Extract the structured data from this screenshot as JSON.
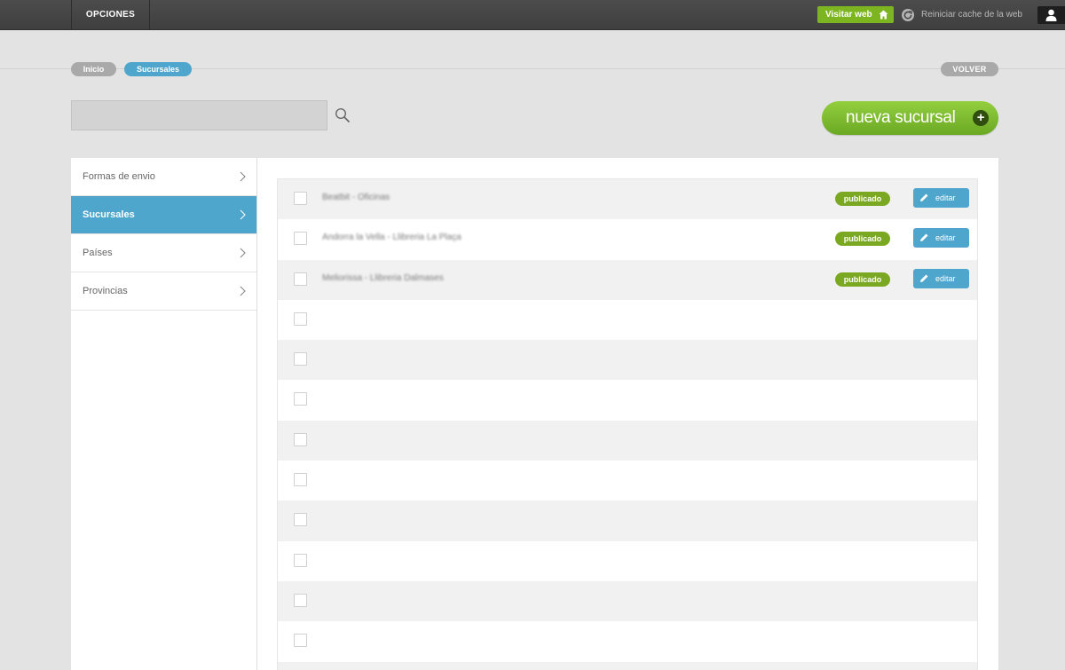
{
  "topbar": {
    "opciones_label": "OPCIONES",
    "visitar_label": "Visitar web",
    "reiniciar_label": "Reiniciar cache de la web"
  },
  "breadcrumb": {
    "items": [
      "Inicio",
      "Sucursales"
    ],
    "back_label": "VOLVER"
  },
  "search": {
    "placeholder": "",
    "value": ""
  },
  "new_button_label": "nueva sucursal",
  "new_button_icon": "+",
  "sidebar": {
    "items": [
      {
        "label": "Formas de envio",
        "active": false
      },
      {
        "label": "Sucursales",
        "active": true
      },
      {
        "label": "Países",
        "active": false
      },
      {
        "label": "Provincias",
        "active": false
      }
    ]
  },
  "list": {
    "rows": [
      {
        "name": "Beatbit - Oficinas",
        "status": "publicado",
        "edit": "editar"
      },
      {
        "name": "Andorra la Vella - Llibreria La Plaça",
        "status": "publicado",
        "edit": "editar"
      },
      {
        "name": "Meliorissa - Llibreria Dalmases",
        "status": "publicado",
        "edit": "editar"
      }
    ],
    "empty_rows": 10
  },
  "colors": {
    "accent_blue": "#4ea6cd",
    "green": "#7db521",
    "topbar": "#444444"
  }
}
